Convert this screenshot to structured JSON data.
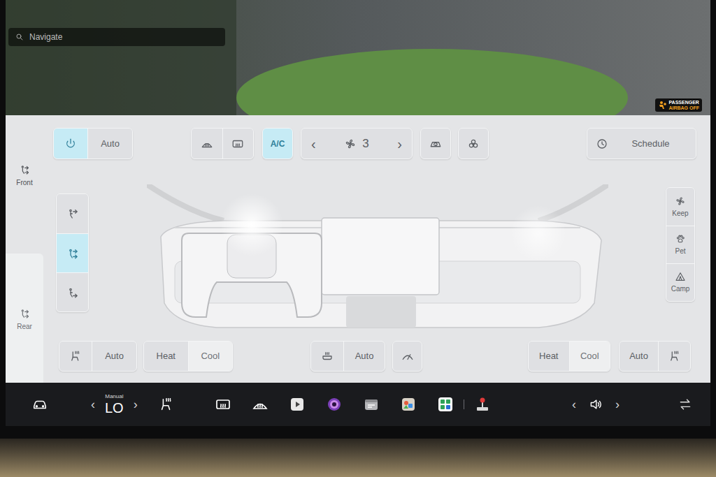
{
  "camera_view": {
    "search_placeholder": "Navigate",
    "airbag_badge": [
      "PASSENGER",
      "AIRBAG OFF"
    ]
  },
  "zone_tabs": [
    {
      "label": "Front",
      "selected": true
    },
    {
      "label": "Rear",
      "selected": false
    }
  ],
  "top_bar": {
    "power": {
      "on": true
    },
    "auto": {
      "label": "Auto",
      "selected": false
    },
    "defrost": [
      {
        "kind": "front",
        "on": false
      },
      {
        "kind": "rear",
        "on": false
      }
    ],
    "ac": {
      "label": "A/C",
      "on": true
    },
    "fan": {
      "prev": "‹",
      "speed": "3",
      "next": "›"
    },
    "recirculate": {
      "on": false
    },
    "bioweapon_defense": {
      "on": false
    },
    "schedule": {
      "label": "Schedule"
    }
  },
  "airflow": [
    {
      "kind": "face",
      "selected": false
    },
    {
      "kind": "face-feet",
      "selected": true
    },
    {
      "kind": "feet",
      "selected": false
    }
  ],
  "modes": [
    {
      "label": "Keep"
    },
    {
      "label": "Pet"
    },
    {
      "label": "Camp"
    }
  ],
  "driver": {
    "seat_heater": {
      "label": "Auto"
    },
    "heat_cool": [
      {
        "label": "Heat",
        "selected": false
      },
      {
        "label": "Cool",
        "selected": true
      }
    ]
  },
  "steering_wheel_heater": {
    "label": "Auto"
  },
  "wiper_defrost": {
    "on": false
  },
  "passenger": {
    "heat_cool": [
      {
        "label": "Heat",
        "selected": false
      },
      {
        "label": "Cool",
        "selected": true
      }
    ],
    "seat_heater": {
      "label": "Auto"
    }
  },
  "taskbar": {
    "temperature": {
      "mode": "Manual",
      "value": "LO",
      "prev": "‹",
      "next": "›"
    },
    "volume": {
      "prev": "‹",
      "next": "›"
    }
  }
}
